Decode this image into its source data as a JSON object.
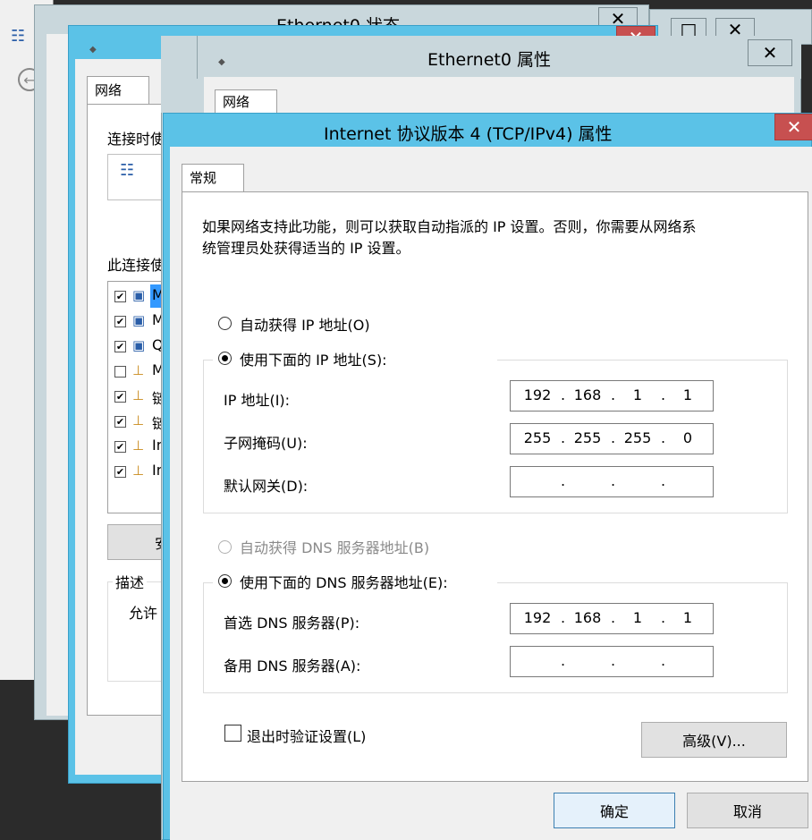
{
  "status_window": {
    "title": "Ethernet0 状态"
  },
  "props_window": {
    "title": "Ethernet0 属性",
    "tab": "网络"
  },
  "left_window": {
    "tab": "网络",
    "connect_label": "连接时使",
    "uses_label": "此连接使",
    "items": [
      {
        "checked": true,
        "text": "M"
      },
      {
        "checked": true,
        "text": "M"
      },
      {
        "checked": true,
        "text": "Q"
      },
      {
        "checked": false,
        "text": "M"
      },
      {
        "checked": true,
        "text": "链"
      },
      {
        "checked": true,
        "text": "链"
      },
      {
        "checked": true,
        "text": "In"
      },
      {
        "checked": true,
        "text": "In"
      }
    ],
    "install_btn": "安",
    "desc_title": "描述",
    "desc_text": "允许"
  },
  "dialog": {
    "title": "Internet 协议版本 4 (TCP/IPv4) 属性",
    "tab": "常规",
    "intro_line1": "如果网络支持此功能，则可以获取自动指派的 IP 设置。否则，你需要从网络系",
    "intro_line2": "统管理员处获得适当的 IP 设置。",
    "auto_ip_label": "自动获得 IP 地址(O)",
    "manual_ip_label": "使用下面的 IP 地址(S):",
    "ip_label": "IP 地址(I):",
    "ip": [
      "192",
      "168",
      "1",
      "1"
    ],
    "mask_label": "子网掩码(U):",
    "mask": [
      "255",
      "255",
      "255",
      "0"
    ],
    "gw_label": "默认网关(D):",
    "gw": [
      "",
      "",
      "",
      ""
    ],
    "auto_dns_label": "自动获得 DNS 服务器地址(B)",
    "manual_dns_label": "使用下面的 DNS 服务器地址(E):",
    "dns1_label": "首选 DNS 服务器(P):",
    "dns1": [
      "192",
      "168",
      "1",
      "1"
    ],
    "dns2_label": "备用 DNS 服务器(A):",
    "dns2": [
      "",
      "",
      "",
      ""
    ],
    "validate_label": "退出时验证设置(L)",
    "advanced_btn": "高级(V)...",
    "ok_btn": "确定",
    "cancel_btn": "取消"
  },
  "colors": {
    "accent": "#5bc2e7",
    "close_red": "#c75050",
    "titlebar_inactive": "#c9d7dc"
  }
}
